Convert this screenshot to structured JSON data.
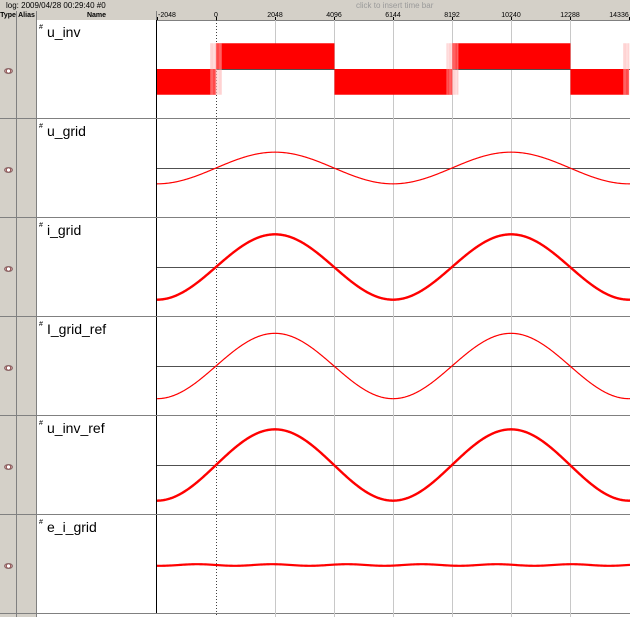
{
  "header": {
    "log_text": "log: 2009/04/28 00:29:40 #0",
    "insert_hint": "click to insert time bar"
  },
  "columns": {
    "type": "Type",
    "alias": "Alias",
    "name": "Name"
  },
  "time_axis": {
    "min": -2048,
    "max": 14336,
    "ticks": [
      {
        "label": "-2048",
        "value": -2048
      },
      {
        "label": "0",
        "value": 0
      },
      {
        "label": "2048",
        "value": 2048
      },
      {
        "label": "4096",
        "value": 4096
      },
      {
        "label": "6144",
        "value": 6144
      },
      {
        "label": "8192",
        "value": 8192
      },
      {
        "label": "10240",
        "value": 10240
      },
      {
        "label": "12288",
        "value": 12288
      },
      {
        "label": "14336",
        "value": 14336
      }
    ]
  },
  "colors": {
    "signal": "#ff0000",
    "grid": "#c8c8c8",
    "baseline": "#505050",
    "chrome": "#d4d0c8"
  },
  "channels": [
    {
      "name": "u_inv",
      "mini": "#",
      "kind": "pwm",
      "amplitude": 0.26
    },
    {
      "name": "u_grid",
      "mini": "#",
      "kind": "sine",
      "amplitude": 0.16
    },
    {
      "name": "i_grid",
      "mini": "#",
      "kind": "sine_thick",
      "amplitude": 0.33
    },
    {
      "name": "I_grid_ref",
      "mini": "#",
      "kind": "sine",
      "amplitude": 0.33
    },
    {
      "name": "u_inv_ref",
      "mini": "#",
      "kind": "sine_thick",
      "amplitude": 0.36
    },
    {
      "name": "e_i_grid",
      "mini": "#",
      "kind": "flat",
      "amplitude": 0.02
    }
  ]
}
